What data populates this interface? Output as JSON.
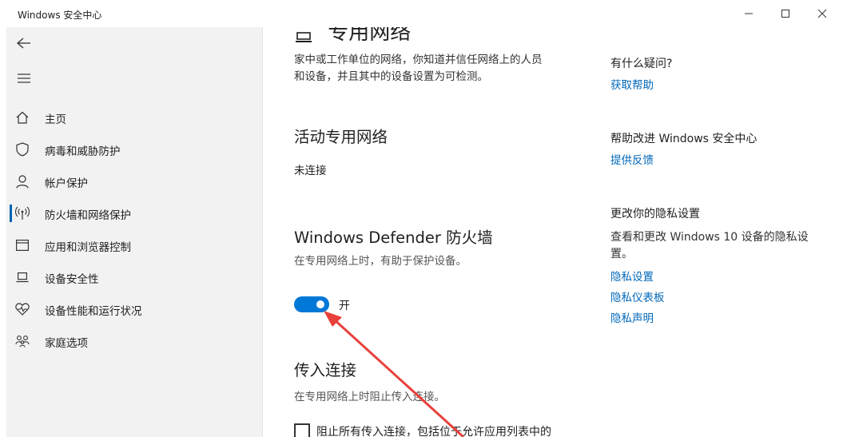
{
  "window": {
    "title": "Windows 安全中心",
    "controls": [
      "minimize-icon",
      "maximize-icon",
      "close-icon"
    ]
  },
  "sidebar": {
    "back_icon": "back-arrow-icon",
    "menu_icon": "hamburger-icon",
    "items": [
      {
        "label": "主页",
        "icon": "home-icon",
        "active": false
      },
      {
        "label": "病毒和威胁防护",
        "icon": "shield-icon",
        "active": false
      },
      {
        "label": "帐户保护",
        "icon": "person-icon",
        "active": false
      },
      {
        "label": "防火墙和网络保护",
        "icon": "wifi-antenna-icon",
        "active": true
      },
      {
        "label": "应用和浏览器控制",
        "icon": "browser-window-icon",
        "active": false
      },
      {
        "label": "设备安全性",
        "icon": "laptop-icon",
        "active": false
      },
      {
        "label": "设备性能和运行状况",
        "icon": "heart-pulse-icon",
        "active": false
      },
      {
        "label": "家庭选项",
        "icon": "family-icon",
        "active": false
      }
    ]
  },
  "main": {
    "page_title": "专用网络",
    "page_desc_line1": "家中或工作单位的网络，你知道并信任网络上的人员",
    "page_desc_line2": "和设备，并且其中的设备设置为可检测。",
    "active_networks": {
      "title": "活动专用网络",
      "value": "未连接"
    },
    "firewall": {
      "title": "Windows Defender 防火墙",
      "desc": "在专用网络上时，有助于保护设备。",
      "toggle_state": "开",
      "toggle_on": true
    },
    "incoming": {
      "title": "传入连接",
      "desc": "在专用网络上时阻止传入连接。",
      "checkbox_label": "阻止所有传入连接，包括位于允许应用列表中的",
      "checked": false
    }
  },
  "right_panel": {
    "questions_title": "有什么疑问?",
    "get_help": "获取帮助",
    "improve_title": "帮助改进 Windows 安全中心",
    "feedback": "提供反馈",
    "privacy_title": "更改你的隐私设置",
    "privacy_desc": "查看和更改 Windows 10 设备的隐私设置。",
    "privacy_link1": "隐私设置",
    "privacy_link2": "隐私仪表板",
    "privacy_link3": "隐私声明"
  },
  "colors": {
    "accent": "#0078d7",
    "link": "#0067b8",
    "annotation_arrow": "#e8413c",
    "sidebar_bg": "#f2f2f2"
  }
}
